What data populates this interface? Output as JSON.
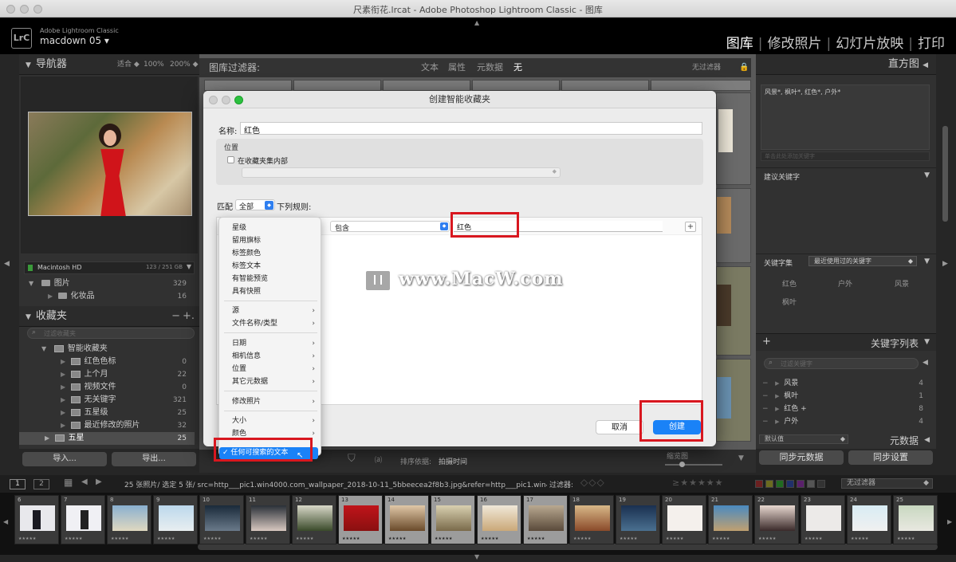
{
  "window": {
    "title": "尺素衔花.lrcat - Adobe Photoshop Lightroom Classic - 图库"
  },
  "identity": {
    "app": "Adobe Lightroom Classic",
    "user": "macdown 05",
    "logo": "LrC"
  },
  "modules": [
    "图库",
    "修改照片",
    "幻灯片放映",
    "打印"
  ],
  "navigator": {
    "title": "导航器",
    "zoom": [
      "适合 ◆",
      "100%",
      "200% ◆"
    ]
  },
  "drive": {
    "name": "Macintosh HD",
    "space": "123 / 251 GB"
  },
  "folders": [
    {
      "name": "图片",
      "count": "329"
    },
    {
      "name": "化妆品",
      "count": "16"
    }
  ],
  "collections": {
    "title": "收藏夹",
    "search_placeholder": "过滤收藏夹",
    "smart_set": "智能收藏夹",
    "items": [
      {
        "name": "红色色标",
        "count": "0"
      },
      {
        "name": "上个月",
        "count": "22"
      },
      {
        "name": "视频文件",
        "count": "0"
      },
      {
        "name": "无关键字",
        "count": "321"
      },
      {
        "name": "五星级",
        "count": "25"
      },
      {
        "name": "最近修改的照片",
        "count": "32"
      },
      {
        "name": "五星",
        "count": "25"
      }
    ]
  },
  "import_export": {
    "import": "导入...",
    "export": "导出..."
  },
  "filter": {
    "title": "图库过滤器:",
    "opts": [
      "文本",
      "属性",
      "元数据",
      "无"
    ],
    "none": "无过滤器"
  },
  "histogram": {
    "title": "直方图"
  },
  "keywords": {
    "tags_text": "风景*, 枫叶*, 红色*, 户外*",
    "tags_placeholder": "单击此处添加关键字",
    "suggest_title": "建议关键字",
    "set_label": "关键字集",
    "set_value": "最近使用过的关键字",
    "set_items": [
      "红色",
      "户外",
      "风景",
      "枫叶"
    ],
    "list_title": "关键字列表",
    "list_search": "过滤关键字",
    "list": [
      {
        "name": "风景",
        "count": "4"
      },
      {
        "name": "枫叶",
        "count": "1"
      },
      {
        "name": "红色 +",
        "count": "8"
      },
      {
        "name": "户外",
        "count": "4"
      }
    ],
    "default_value": "默认值",
    "metadata_title": "元数据"
  },
  "sync": {
    "metadata": "同步元数据",
    "settings": "同步设置"
  },
  "toolbar": {
    "sort_label": "排序依据:",
    "sort_value": "拍摄时间",
    "thumbs_label": "缩览图"
  },
  "filmstrip_info": {
    "text": "25 张照片/ 选定 5 张/ src=http___pic1.win4000.com_wallpaper_2018-10-11_5bbeecea2f8b3.jpg&refer=http___pic1.win4000.",
    "filter_label": "过滤器:",
    "filter_value": "无过滤器",
    "pages": [
      "1",
      "2"
    ]
  },
  "filmstrip": [
    "6",
    "7",
    "8",
    "9",
    "10",
    "11",
    "12",
    "13",
    "14",
    "15",
    "16",
    "17",
    "18",
    "19",
    "20",
    "21",
    "22",
    "23",
    "24",
    "25"
  ],
  "dialog": {
    "title": "创建智能收藏夹",
    "name_label": "名称:",
    "name_value": "红色",
    "location_label": "位置",
    "inside_label": "在收藏夹集内部",
    "match_label": "匹配",
    "match_value": "全部",
    "rules_label": "下列规则:",
    "rule_op": "包含",
    "rule_value": "红色",
    "plus": "+",
    "cancel": "取消",
    "create": "创建",
    "watermark": "www.MacW.com"
  },
  "menu": {
    "group1": [
      "星级",
      "留用旗标",
      "标签颜色",
      "标签文本",
      "有智能预览",
      "具有快照"
    ],
    "group2": [
      "源",
      "文件名称/类型"
    ],
    "group3": [
      "日期",
      "相机信息",
      "位置",
      "其它元数据"
    ],
    "group4": [
      "修改照片"
    ],
    "group5": [
      "大小",
      "颜色"
    ],
    "selected": "✓ 任何可搜索的文本"
  },
  "colors": {
    "accent": "#1a82f7",
    "highlight": "#d8171f",
    "panel": "#313131"
  }
}
